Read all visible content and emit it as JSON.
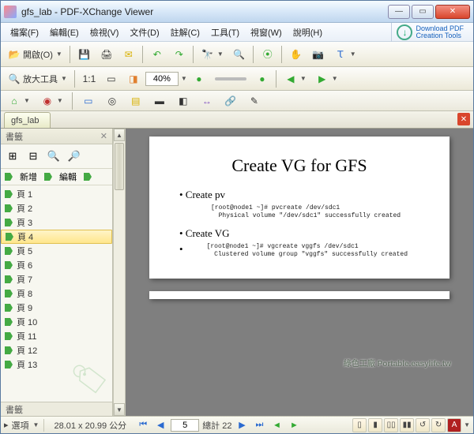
{
  "window": {
    "title": "gfs_lab - PDF-XChange Viewer"
  },
  "menu": {
    "file": "檔案(F)",
    "edit": "編輯(E)",
    "view": "檢視(V)",
    "document": "文件(D)",
    "comment": "註解(C)",
    "tools": "工具(T)",
    "window": "視窗(W)",
    "help": "說明(H)",
    "download1": "Download PDF",
    "download2": "Creation Tools"
  },
  "toolbar": {
    "open": "開啟(O)",
    "zoomtool": "放大工具",
    "zoom_value": "40%"
  },
  "tabs": {
    "doc": "gfs_lab"
  },
  "sidebar": {
    "title": "書籤",
    "new": "新增",
    "edit": "編輯",
    "footer": "書籤",
    "items": [
      {
        "label": "頁 1"
      },
      {
        "label": "頁 2"
      },
      {
        "label": "頁 3"
      },
      {
        "label": "頁 4"
      },
      {
        "label": "頁 5"
      },
      {
        "label": "頁 6"
      },
      {
        "label": "頁 7"
      },
      {
        "label": "頁 8"
      },
      {
        "label": "頁 9"
      },
      {
        "label": "頁 10"
      },
      {
        "label": "頁 11"
      },
      {
        "label": "頁 12"
      },
      {
        "label": "頁 13"
      }
    ],
    "selected_index": 3
  },
  "page": {
    "heading": "Create VG for GFS",
    "b1": "• Create pv",
    "code1": "[root@node1 ~]# pvcreate /dev/sdc1\n  Physical volume \"/dev/sdc1\" successfully created",
    "b2": "• Create VG",
    "b2dot": "•",
    "code2": "[root@node1 ~]# vgcreate vggfs /dev/sdc1\n  Clustered volume group \"vggfs\" successfully created"
  },
  "watermark": "綠色工廠 Portable.easylife.tw",
  "status": {
    "options": "選項",
    "dims": "28.01 x 20.99 公分",
    "page_current": "5",
    "page_total_label": "總計 22"
  }
}
